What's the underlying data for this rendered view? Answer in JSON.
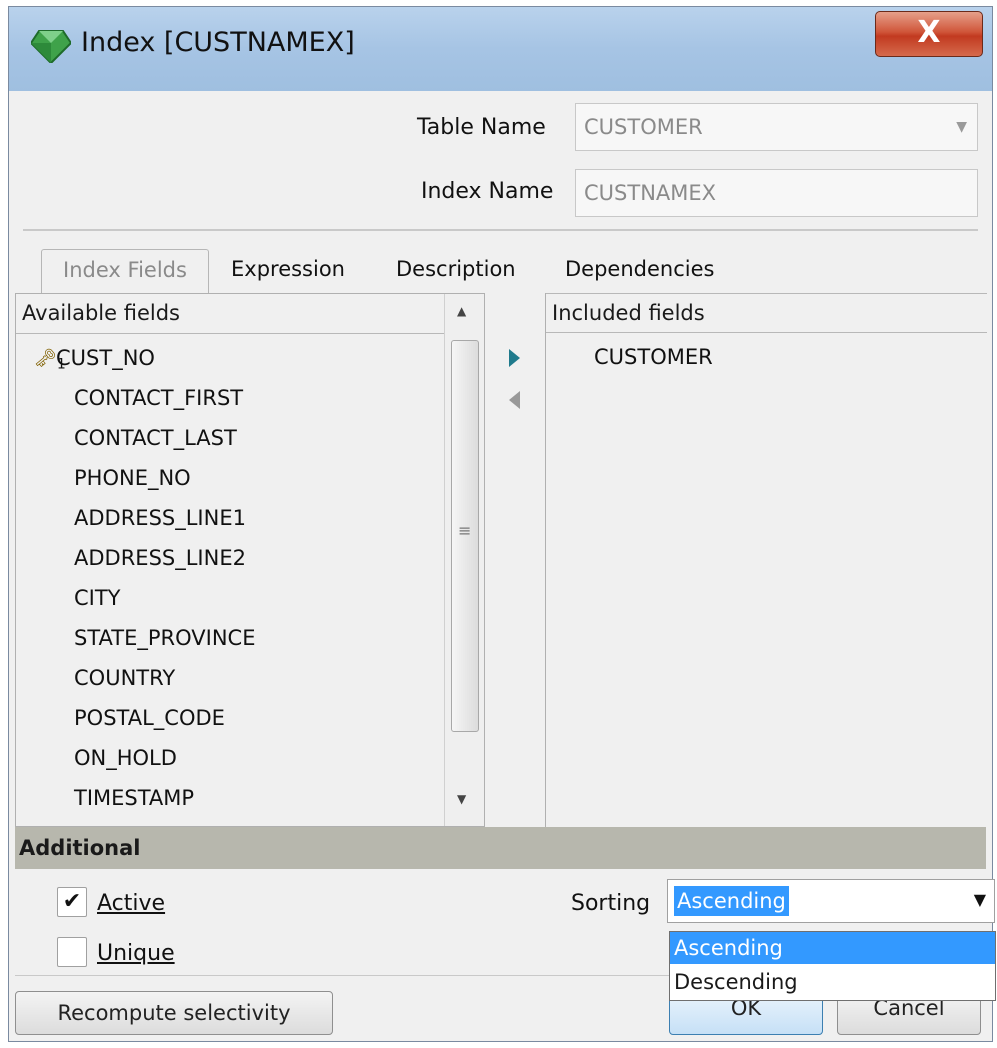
{
  "window": {
    "title": "Index [CUSTNAMEX]",
    "close_glyph": "X"
  },
  "form": {
    "table_name_label": "Table Name",
    "table_name_value": "CUSTOMER",
    "index_name_label": "Index Name",
    "index_name_value": "CUSTNAMEX"
  },
  "tabs": [
    {
      "label": "Index Fields",
      "active": true
    },
    {
      "label": "Expression"
    },
    {
      "label": "Description"
    },
    {
      "label": "Dependencies"
    }
  ],
  "available": {
    "header": "Available fields",
    "key_marker": "1",
    "items": [
      "CUST_NO",
      "CONTACT_FIRST",
      "CONTACT_LAST",
      "PHONE_NO",
      "ADDRESS_LINE1",
      "ADDRESS_LINE2",
      "CITY",
      "STATE_PROVINCE",
      "COUNTRY",
      "POSTAL_CODE",
      "ON_HOLD",
      "TIMESTAMP"
    ]
  },
  "included": {
    "header": "Included fields",
    "items": [
      "CUSTOMER"
    ]
  },
  "additional": {
    "header": "Additional",
    "active_label": "Active",
    "active_checked": true,
    "unique_label": "Unique",
    "unique_checked": false,
    "sorting_label": "Sorting",
    "sorting_value": "Ascending",
    "sorting_options": [
      "Ascending",
      "Descending"
    ],
    "highlighted_option": "Ascending"
  },
  "buttons": {
    "recompute": "Recompute selectivity",
    "ok": "OK",
    "cancel": "Cancel"
  },
  "icons": {
    "app": "green-gem-icon",
    "key": "key-icon"
  },
  "colors": {
    "selection": "#3399ff",
    "section_bar": "#b7b7ad",
    "arrow_active": "#1f7a8c"
  }
}
